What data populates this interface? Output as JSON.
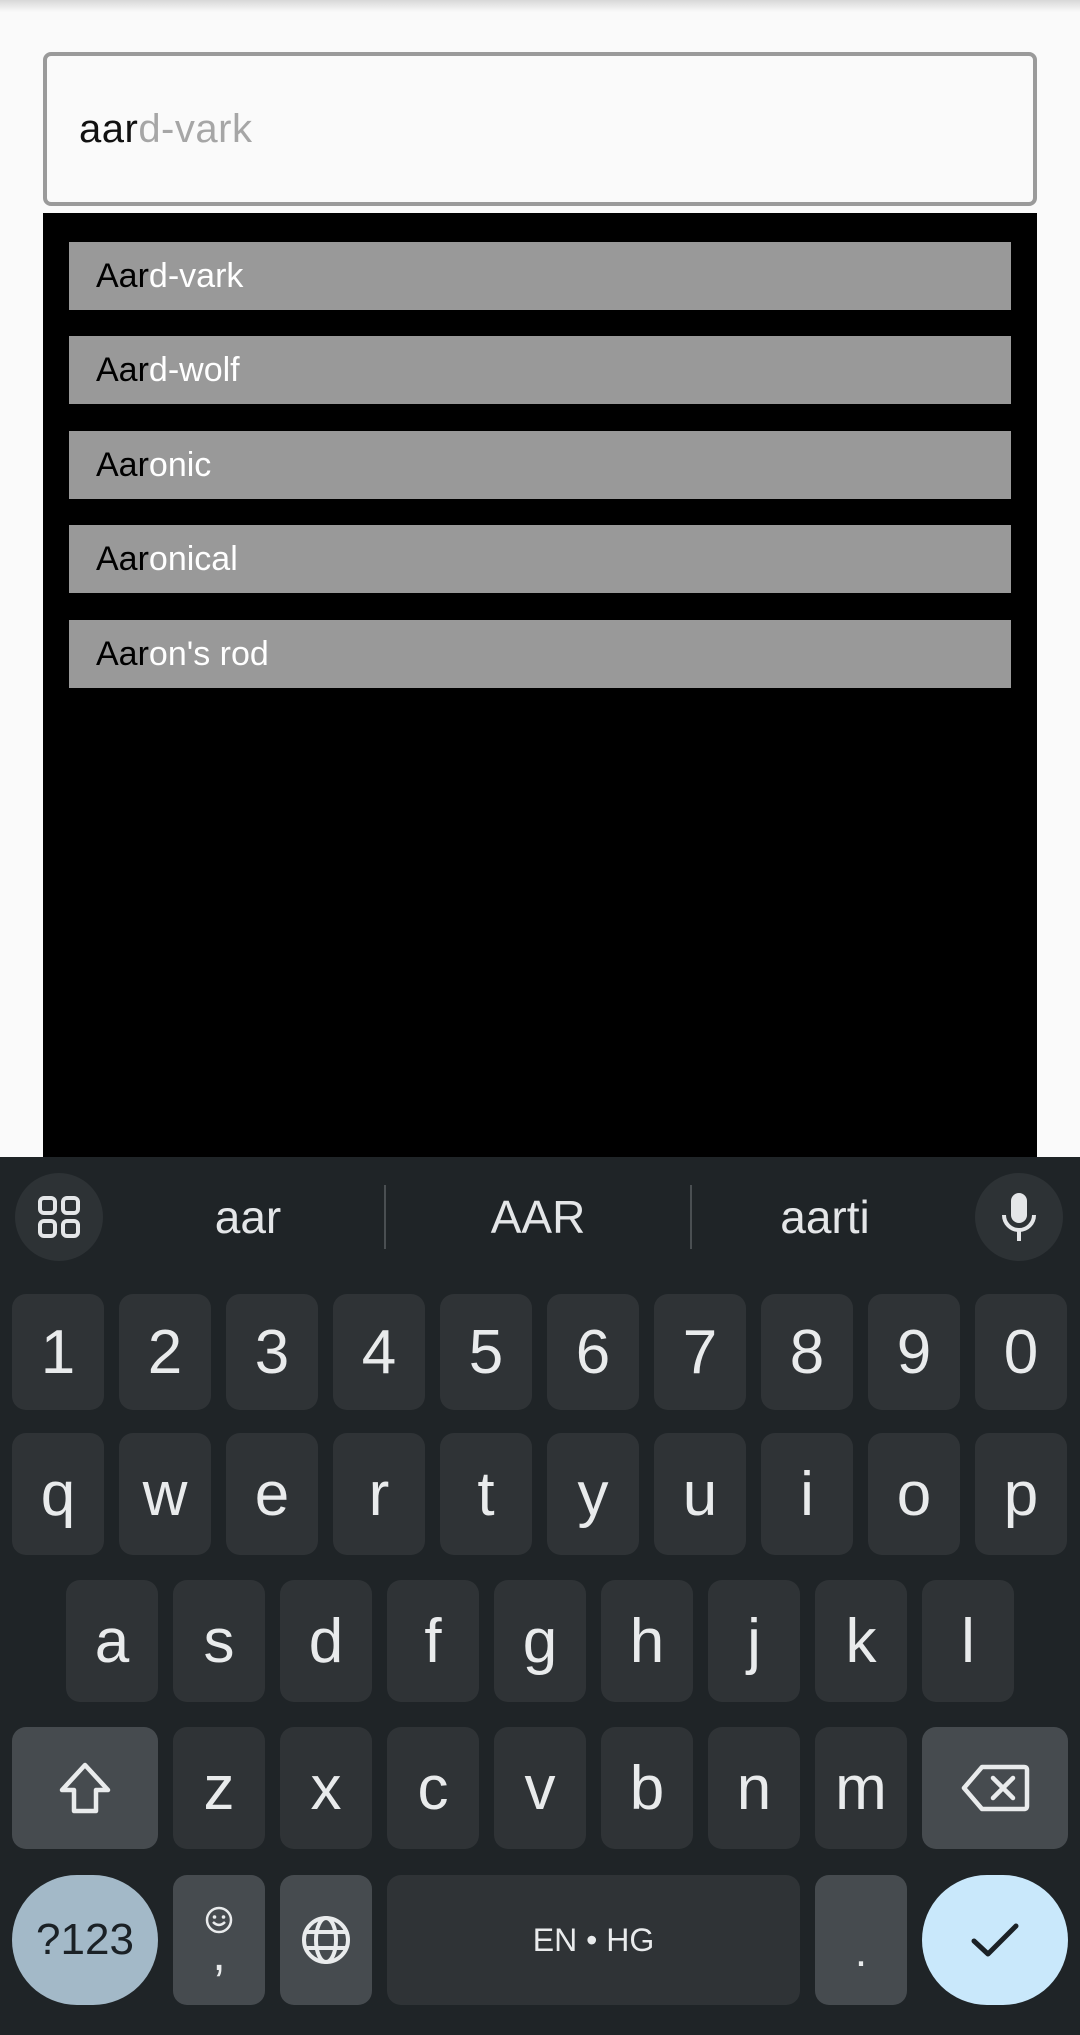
{
  "search": {
    "typed": "aar",
    "completion": "d-vark"
  },
  "suggestions": [
    {
      "prefix": "Aar",
      "rest": "d-vark"
    },
    {
      "prefix": "Aar",
      "rest": "d-wolf"
    },
    {
      "prefix": "Aar",
      "rest": "onic"
    },
    {
      "prefix": "Aar",
      "rest": "onical"
    },
    {
      "prefix": "Aar",
      "rest": "on's rod"
    }
  ],
  "keyboard": {
    "word_suggestions": [
      "aar",
      "AAR",
      "aarti"
    ],
    "number_row": [
      "1",
      "2",
      "3",
      "4",
      "5",
      "6",
      "7",
      "8",
      "9",
      "0"
    ],
    "row1": [
      "q",
      "w",
      "e",
      "r",
      "t",
      "y",
      "u",
      "i",
      "o",
      "p"
    ],
    "row2": [
      "a",
      "s",
      "d",
      "f",
      "g",
      "h",
      "j",
      "k",
      "l"
    ],
    "row3": [
      "z",
      "x",
      "c",
      "v",
      "b",
      "n",
      "m"
    ],
    "symbols_label": "?123",
    "comma_label": ",",
    "space_label": "EN • HG",
    "period_label": ".",
    "icons": [
      "apps-grid-icon",
      "microphone-icon",
      "shift-icon",
      "backspace-icon",
      "emoji-icon",
      "globe-icon",
      "checkmark-icon"
    ]
  }
}
